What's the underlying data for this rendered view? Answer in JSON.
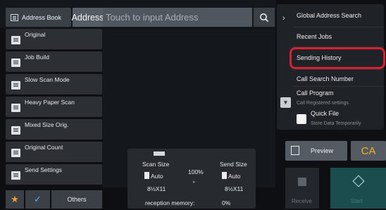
{
  "header": {
    "address_book_label": "Address Book",
    "address_label": "Address",
    "address_placeholder": "Touch to input Address"
  },
  "left_modes": [
    {
      "label": "Original"
    },
    {
      "label": "Job Build"
    },
    {
      "label": "Slow Scan Mode"
    },
    {
      "label": "Heavy Paper Scan"
    },
    {
      "label": "Mixed Size Orig."
    },
    {
      "label": "Original Count"
    },
    {
      "label": "Send Settings"
    }
  ],
  "bottom_left": {
    "others_label": "Others"
  },
  "center": {
    "scan_size_label": "Scan Size",
    "scan_size_value": "Auto",
    "scan_paper": "8½X11",
    "ratio": "100%",
    "send_size_label": "Send Size",
    "send_size_value": "Auto",
    "send_paper": "8½X11",
    "memory_label": "reception memory:",
    "memory_value": "0%"
  },
  "menu": {
    "global_search": "Global Address Search",
    "recent_jobs": "Recent Jobs",
    "sending_history": "Sending History",
    "call_search_number": "Call Search Number",
    "call_program": "Call Program",
    "call_program_sub": "Call Registered settings",
    "quick_file": "Quick File",
    "quick_file_sub": "Store Data Temporarily"
  },
  "actions": {
    "preview_label": "Preview",
    "ca_label": "CA",
    "receive_label": "Receive",
    "start_label": "Start"
  },
  "colors": {
    "highlight": "#d82030",
    "accent_star": "#f0a030",
    "accent_check": "#4fb6e8",
    "ca_text": "#f0b020",
    "start_bg": "#1c4d4e"
  }
}
